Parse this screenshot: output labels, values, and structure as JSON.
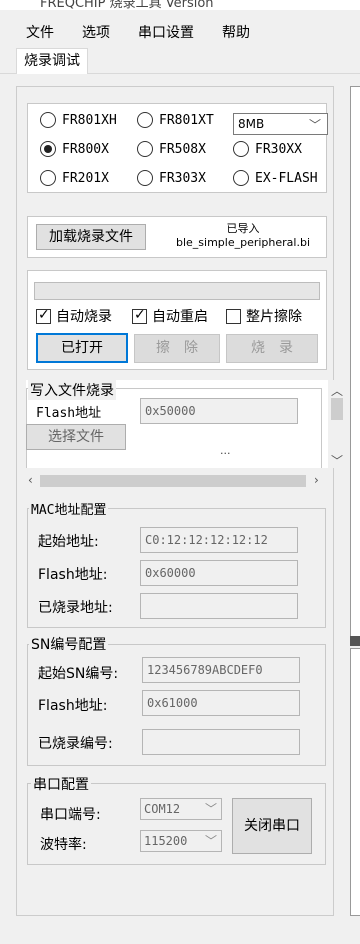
{
  "window": {
    "title": "FREQCHIP 烧录工具 Version"
  },
  "menu": [
    "文件",
    "选项",
    "串口设置",
    "帮助"
  ],
  "tab": {
    "label": "烧录调试"
  },
  "chip_options": [
    {
      "label": "FR801XH",
      "selected": false
    },
    {
      "label": "FR801XT",
      "selected": false
    },
    {
      "label": "FR800X",
      "selected": true
    },
    {
      "label": "FR508X",
      "selected": false
    },
    {
      "label": "FR30XX",
      "selected": false
    },
    {
      "label": "FR201X",
      "selected": false
    },
    {
      "label": "FR303X",
      "selected": false
    },
    {
      "label": "EX-FLASH",
      "selected": false
    }
  ],
  "flash_size": {
    "value": "8MB"
  },
  "load": {
    "button": "加载烧录文件",
    "status": "已导入",
    "filename": "ble_simple_peripheral.bi"
  },
  "progress": {
    "percent": 0
  },
  "checks": [
    {
      "label": "自动烧录",
      "checked": true
    },
    {
      "label": "自动重启",
      "checked": true
    },
    {
      "label": "整片擦除",
      "checked": false
    }
  ],
  "actions": {
    "open": "已打开",
    "erase": "擦除",
    "burn": "烧录"
  },
  "write_group": {
    "title": "写入文件烧录",
    "flash_label": "Flash地址",
    "flash_value": "0x50000",
    "select_button": "选择文件",
    "ellipsis": "..."
  },
  "mac_group": {
    "title": "MAC地址配置",
    "start_label": "起始地址:",
    "start_value": "C0:12:12:12:12:12",
    "flash_label": "Flash地址:",
    "flash_value": "0x60000",
    "burned_label": "已烧录地址:",
    "burned_value": ""
  },
  "sn_group": {
    "title": "SN编号配置",
    "start_label": "起始SN编号:",
    "start_value": "123456789ABCDEF0",
    "flash_label": "Flash地址:",
    "flash_value": "0x61000",
    "burned_label": "已烧录编号:",
    "burned_value": ""
  },
  "serial_group": {
    "title": "串口配置",
    "port_label": "串口端号:",
    "port_value": "COM12",
    "baud_label": "波特率:",
    "baud_value": "115200",
    "close_button": "关闭串口"
  },
  "colors": {
    "accent": "#0078d7"
  }
}
